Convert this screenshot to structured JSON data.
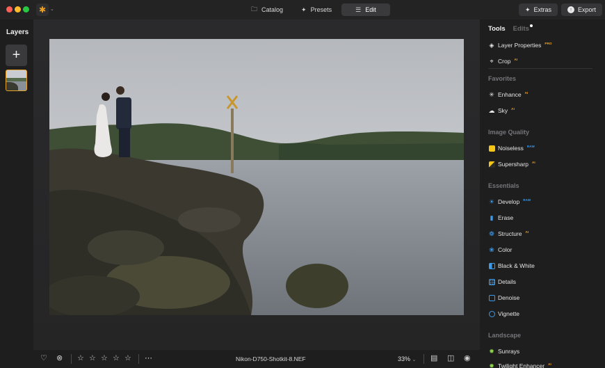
{
  "titlebar": {
    "modes": [
      {
        "label": "Catalog",
        "icon": "folder-icon"
      },
      {
        "label": "Presets",
        "icon": "presets-icon"
      },
      {
        "label": "Edit",
        "icon": "sliders-icon"
      }
    ],
    "active_mode": "Edit",
    "extras_label": "Extras",
    "export_label": "Export"
  },
  "layers": {
    "title": "Layers"
  },
  "photo": {
    "filename": "Nikon-D750-Shotkit-8.NEF",
    "zoom": "33%"
  },
  "tools_panel": {
    "tabs": [
      "Tools",
      "Edits"
    ],
    "active_tab": "Tools",
    "top_tools": [
      {
        "label": "Layer Properties",
        "badge": "PRO",
        "icon": "layers-icon"
      },
      {
        "label": "Crop",
        "badge": "AI",
        "icon": "crop-icon"
      }
    ],
    "sections": [
      {
        "title": "Favorites",
        "tools": [
          {
            "label": "Enhance",
            "badge": "AI",
            "icon": "enhance-icon"
          },
          {
            "label": "Sky",
            "badge": "AI",
            "icon": "cloud-icon"
          }
        ]
      },
      {
        "title": "Image Quality",
        "tools": [
          {
            "label": "Noiseless",
            "badge": "RAW",
            "icon": "noiseless-icon"
          },
          {
            "label": "Supersharp",
            "badge": "AI",
            "icon": "supersharp-icon"
          }
        ]
      },
      {
        "title": "Essentials",
        "tools": [
          {
            "label": "Develop",
            "badge": "RAW",
            "icon": "sun-icon"
          },
          {
            "label": "Erase",
            "badge": "",
            "icon": "eraser-icon"
          },
          {
            "label": "Structure",
            "badge": "AI",
            "icon": "structure-icon"
          },
          {
            "label": "Color",
            "badge": "",
            "icon": "color-icon"
          },
          {
            "label": "Black & White",
            "badge": "",
            "icon": "black-white-icon"
          },
          {
            "label": "Details",
            "badge": "",
            "icon": "details-icon"
          },
          {
            "label": "Denoise",
            "badge": "",
            "icon": "denoise-icon"
          },
          {
            "label": "Vignette",
            "badge": "",
            "icon": "vignette-icon"
          }
        ]
      },
      {
        "title": "Landscape",
        "tools": [
          {
            "label": "Sunrays",
            "badge": "",
            "icon": "sunrays-icon"
          },
          {
            "label": "Twilight Enhancer",
            "badge": "AI",
            "icon": "twilight-icon"
          }
        ]
      }
    ]
  },
  "colors": {
    "accent": "#f3a41c",
    "raw_badge": "#3d9ae8",
    "background": "#1e1e1f"
  }
}
